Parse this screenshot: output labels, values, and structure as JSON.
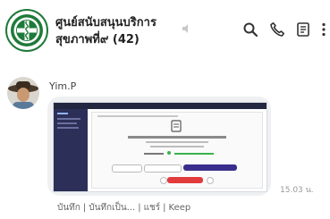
{
  "header": {
    "title_line1": "ศูนย์สนับสนุนบริการ",
    "title_line2": "สุขภาพที่๙ (42)",
    "icons": [
      "mute-icon",
      "search-icon",
      "call-icon",
      "notes-icon",
      "more-vertical-icon"
    ]
  },
  "message": {
    "sender": "Yim.P",
    "time": "15.03 น."
  },
  "note_tabs": [
    "บันทึก",
    "บันทึกเป็น...",
    "แชร์",
    "Keep"
  ],
  "colors": {
    "logo_green": "#1f7a3a",
    "bubble_bg": "#eef0f2",
    "button_purple": "#3a2e8c",
    "sidebar_dark": "#2c2f57"
  }
}
